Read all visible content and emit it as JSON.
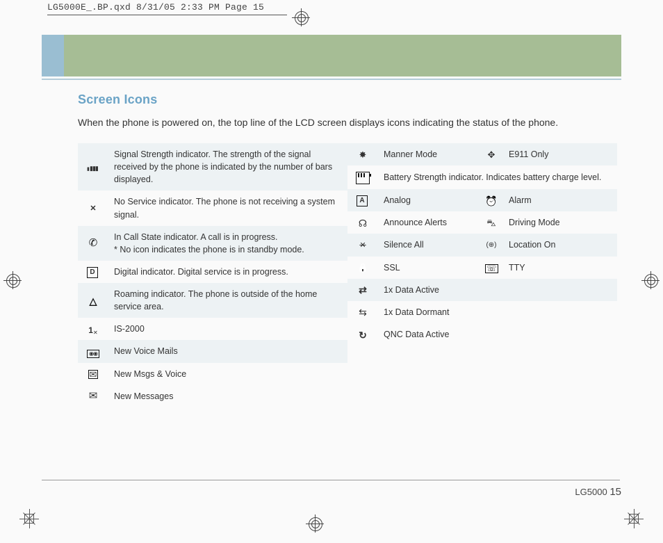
{
  "crop_header": "LG5000E_.BP.qxd  8/31/05  2:33 PM  Page 15",
  "title": "Screen Icons",
  "intro": "When the phone is powered on, the top line of the LCD screen displays icons indicating the status of the phone.",
  "left_rows": [
    {
      "icon": "signal-strength-icon",
      "desc": "Signal Strength indicator. The strength of the signal received by the phone is indicated by the number of bars displayed.",
      "shade": true
    },
    {
      "icon": "no-service-icon",
      "desc": "No Service indicator. The phone is not receiving a system signal.",
      "shade": false
    },
    {
      "icon": "in-call-icon",
      "desc": "In Call State indicator. A call is in progress.\n* No icon indicates the phone is in standby mode.",
      "shade": true
    },
    {
      "icon": "digital-icon",
      "desc": "Digital indicator. Digital service is in progress.",
      "shade": false
    },
    {
      "icon": "roaming-icon",
      "desc": "Roaming indicator. The phone is outside of the home service area.",
      "shade": true
    },
    {
      "icon": "is2000-icon",
      "desc": "IS-2000",
      "shade": false
    },
    {
      "icon": "voicemail-icon",
      "desc": "New Voice Mails",
      "shade": true
    },
    {
      "icon": "msgs-voice-icon",
      "desc": "New Msgs & Voice",
      "shade": false
    },
    {
      "icon": "new-messages-icon",
      "desc": "New Messages",
      "shade": false
    }
  ],
  "right_rows": [
    {
      "iconA": "manner-mode-icon",
      "labelA": "Manner Mode",
      "iconB": "e911-icon",
      "labelB": "E911 Only",
      "shade": true
    },
    {
      "iconA": "battery-icon",
      "labelA": "Battery Strength indicator. Indicates battery charge level.",
      "span": true,
      "shade": false
    },
    {
      "iconA": "analog-icon",
      "labelA": "Analog",
      "iconB": "alarm-icon",
      "labelB": "Alarm",
      "shade": true
    },
    {
      "iconA": "announce-alerts-icon",
      "labelA": "Announce Alerts",
      "iconB": "driving-mode-icon",
      "labelB": "Driving Mode",
      "shade": false
    },
    {
      "iconA": "silence-all-icon",
      "labelA": "Silence All",
      "iconB": "location-on-icon",
      "labelB": "Location On",
      "shade": true
    },
    {
      "iconA": "ssl-icon",
      "labelA": "SSL",
      "iconB": "tty-icon",
      "labelB": "TTY",
      "shade": false
    },
    {
      "iconA": "data-active-icon",
      "labelA": "1x Data Active",
      "shade": true
    },
    {
      "iconA": "data-dormant-icon",
      "labelA": "1x Data Dormant",
      "shade": false
    },
    {
      "iconA": "qnc-data-icon",
      "labelA": "QNC Data Active",
      "shade": false
    }
  ],
  "footer_model": "LG5000",
  "footer_page": "15"
}
